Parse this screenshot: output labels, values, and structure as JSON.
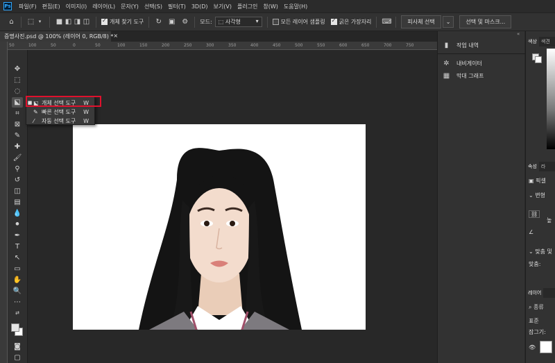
{
  "menubar": {
    "logo": "Ps",
    "items": [
      "파일(F)",
      "편집(E)",
      "이미지(I)",
      "레이어(L)",
      "문자(Y)",
      "선택(S)",
      "필터(T)",
      "3D(D)",
      "보기(V)",
      "플러그인",
      "창(W)",
      "도움말(H)"
    ]
  },
  "options": {
    "object_finder_label": "개체 찾기 도구",
    "mode_label": "모드:",
    "mode_value": "사각형",
    "sample_all_layers_label": "모든 레이어 샘플링",
    "hard_edge_label": "굵은 가장자리",
    "subject_select_btn": "피사체 선택",
    "select_mask_btn": "선택 및 마스크..."
  },
  "document": {
    "tab_title": "증명사진.psd @ 100% (레이어 0, RGB/8) *",
    "close_glyph": "×"
  },
  "ruler": {
    "ticks": [
      "50",
      "100",
      "50",
      "0",
      "50",
      "100",
      "150",
      "200",
      "250",
      "300",
      "350",
      "400",
      "450",
      "500",
      "550",
      "600",
      "650",
      "700",
      "750"
    ]
  },
  "flyout": {
    "items": [
      {
        "label": "개체 선택 도구",
        "key": "W",
        "bullet": "■"
      },
      {
        "label": "빠른 선택 도구",
        "key": "W",
        "bullet": ""
      },
      {
        "label": "자동 선택 도구",
        "key": "W",
        "bullet": ""
      }
    ]
  },
  "panel_mid": {
    "items": [
      "작업 내역",
      "내비게이터",
      "막대 그래프"
    ]
  },
  "panel_right": {
    "color_tab": "색상",
    "swatch_tab": "색견",
    "props_tab": "속성",
    "layers_tab2": "라",
    "pixel_label": "픽셀",
    "transform_label": "변형",
    "height_abbr": "높",
    "align_label": "맞춤 및",
    "align_sub": "맞춤:",
    "layers_tab": "레이어",
    "filter_label": "종류",
    "blend_label": "표준",
    "lock_label": "잠그기:"
  },
  "colors": {
    "accent": "#31a8ff",
    "highlight": "#e0112d"
  }
}
